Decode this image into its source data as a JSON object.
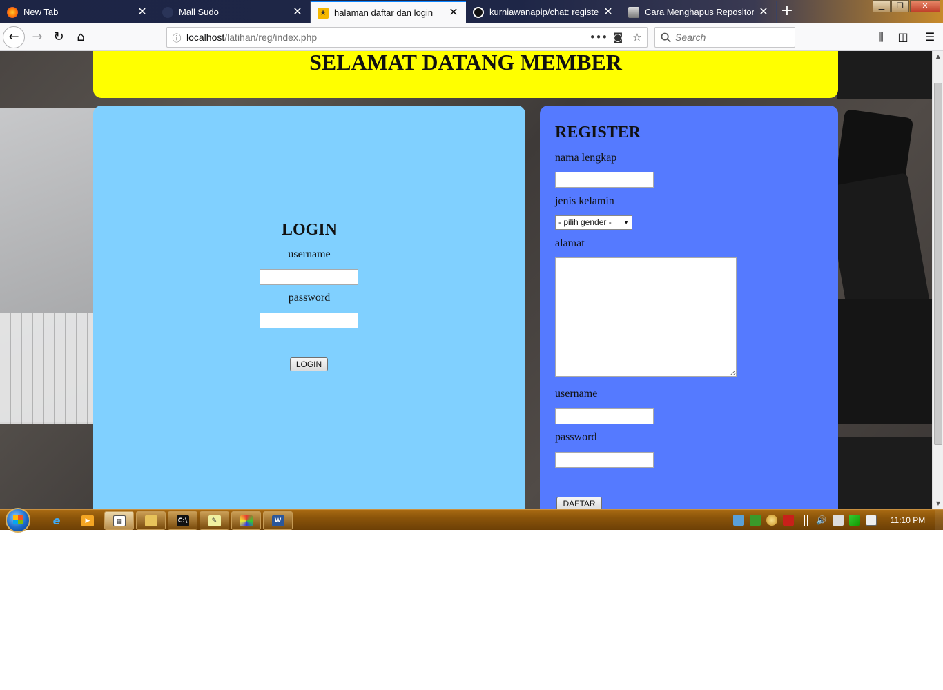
{
  "browser": {
    "tabs": [
      {
        "title": "New Tab",
        "active": false,
        "icon": "firefox-icon"
      },
      {
        "title": "Mall Sudo",
        "active": false,
        "icon": "page-icon"
      },
      {
        "title": "halaman daftar dan login",
        "active": true,
        "icon": "site-icon"
      },
      {
        "title": "kurniawanapip/chat: register,lo",
        "active": false,
        "icon": "github-icon"
      },
      {
        "title": "Cara Menghapus Repository Di",
        "active": false,
        "icon": "avatar-icon"
      }
    ],
    "close_glyph": "✕",
    "new_tab_glyph": "+",
    "url_host": "localhost",
    "url_path": "/latihan/reg/index.php",
    "search_placeholder": "Search"
  },
  "page": {
    "header_title": "SELAMAT DATANG MEMBER",
    "login": {
      "title": "LOGIN",
      "username_label": "username",
      "password_label": "password",
      "submit_label": "LOGIN"
    },
    "register": {
      "title": "REGISTER",
      "fullname_label": "nama lengkap",
      "gender_label": "jenis kelamin",
      "gender_selected": "- pilih gender -",
      "address_label": "alamat",
      "username_label": "username",
      "password_label": "password",
      "submit_label": "DAFTAR"
    },
    "colors": {
      "header": "#ffff00",
      "login_panel": "#80d0ff",
      "register_panel": "#557aff"
    }
  },
  "taskbar": {
    "clock": "11:10 PM",
    "word_label": "W"
  }
}
